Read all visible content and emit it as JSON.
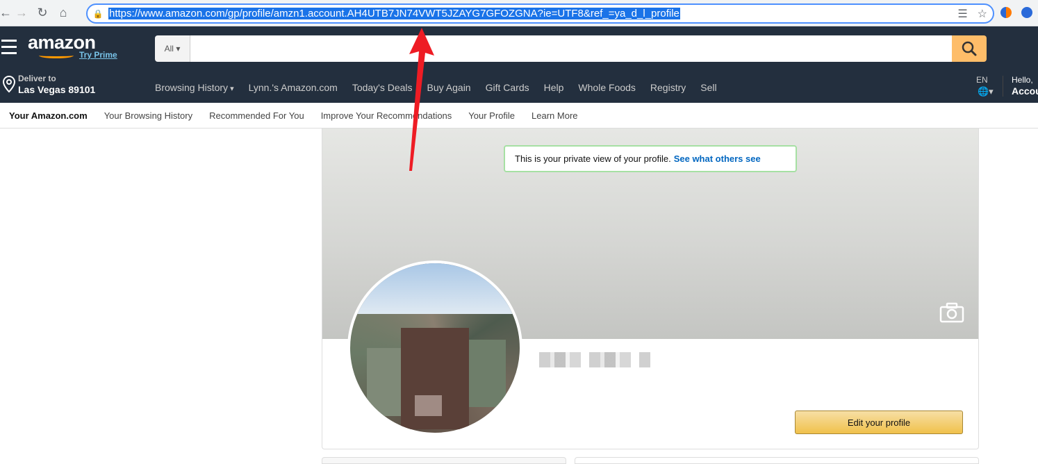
{
  "browser": {
    "url": "https://www.amazon.com/gp/profile/amzn1.account.AH4UTB7JN74VWT5JZAYG7GFOZGNA?ie=UTF8&ref_=ya_d_l_profile",
    "icons": [
      "back-icon",
      "forward-icon",
      "reload-icon",
      "home-icon",
      "lock-icon",
      "translate-icon",
      "star-icon"
    ]
  },
  "header": {
    "logo": "amazon",
    "try_prime": "Try Prime",
    "search_category": "All",
    "search_placeholder": "",
    "deliver_line1": "Deliver to",
    "deliver_line2": "Las Vegas 89101",
    "nav_links": [
      "Browsing History",
      "Lynn.'s Amazon.com",
      "Today's Deals",
      "Buy Again",
      "Gift Cards",
      "Help",
      "Whole Foods",
      "Registry",
      "Sell"
    ],
    "lang": "EN",
    "hello": "Hello,",
    "account": "Account",
    "colors": {
      "nav_bg": "#232f3e",
      "search_btn": "#febd69",
      "accent": "#ff9900"
    }
  },
  "subnav": {
    "items": [
      "Your Amazon.com",
      "Your Browsing History",
      "Recommended For You",
      "Improve Your Recommendations",
      "Your Profile",
      "Learn More"
    ],
    "active_index": 0
  },
  "profile": {
    "private_note": "This is your private view of your profile.",
    "see_others": "See what others see",
    "edit_button": "Edit your profile"
  }
}
